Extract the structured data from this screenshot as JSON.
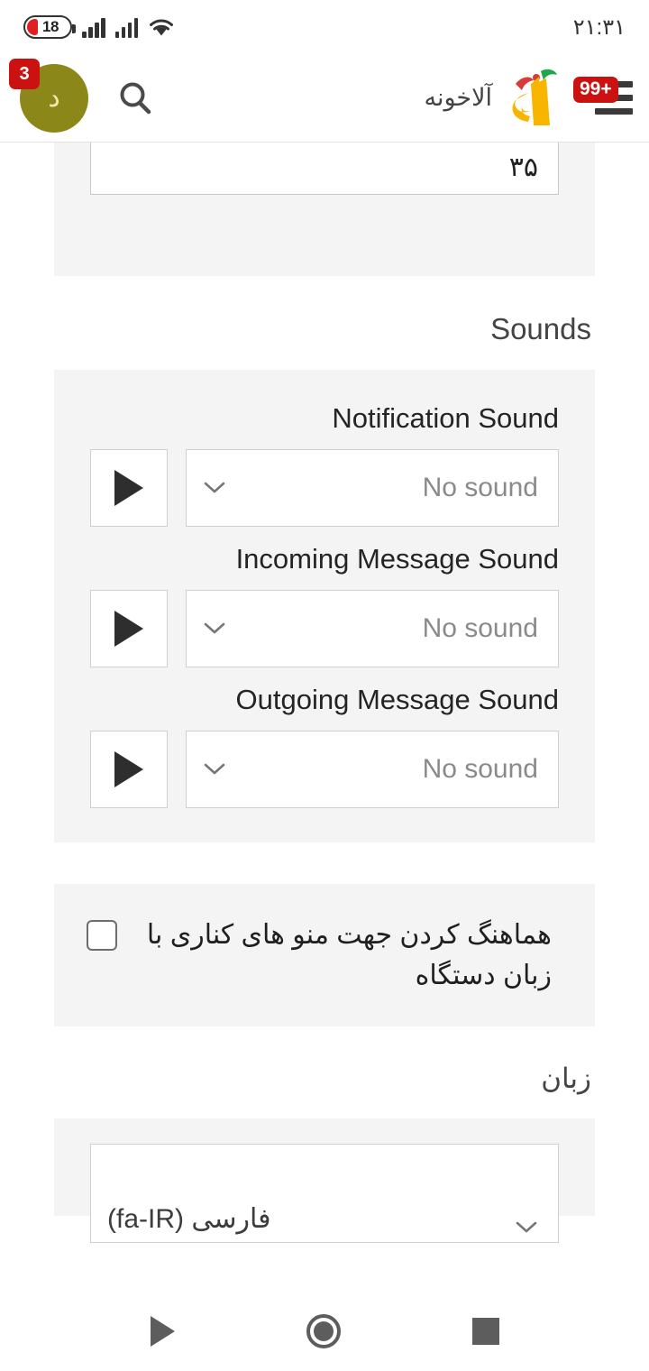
{
  "status_bar": {
    "battery_level": "18",
    "time": "۲۱:۳۱",
    "battery_icon": "battery-icon",
    "signal_icon": "signal-bars-icon",
    "wifi_icon": "wifi-icon"
  },
  "header": {
    "app_title": "آلاخونه",
    "menu_badge": "+99",
    "avatar_badge": "3",
    "avatar_initial": "د",
    "logo_alt": "ala-logo",
    "search_icon": "search-icon",
    "menu_icon": "hamburger-menu-icon"
  },
  "content": {
    "top_field": {
      "value": "۳۵"
    },
    "sounds_section": {
      "title": "Sounds",
      "rows": [
        {
          "label": "Notification Sound",
          "value": "No sound",
          "play_icon": "play-icon",
          "chevron": "chevron-down-icon"
        },
        {
          "label": "Incoming Message Sound",
          "value": "No sound",
          "play_icon": "play-icon",
          "chevron": "chevron-down-icon"
        },
        {
          "label": "Outgoing Message Sound",
          "value": "No sound",
          "play_icon": "play-icon",
          "chevron": "chevron-down-icon"
        }
      ]
    },
    "sync_checkbox": {
      "label": "هماهنگ کردن جهت منو های کناری با زبان دستگاه",
      "checked": false
    },
    "language_section": {
      "title": "زبان",
      "selected": "فارسی (fa-IR)"
    }
  },
  "nav_bar": {
    "back_icon": "back-triangle-icon",
    "home_icon": "home-circle-icon",
    "recents_icon": "recents-square-icon"
  },
  "colors": {
    "accent_red": "#cc1111",
    "avatar_olive": "#8b8718",
    "card_gray": "#f4f4f4",
    "logo_yellow": "#f7b500"
  }
}
